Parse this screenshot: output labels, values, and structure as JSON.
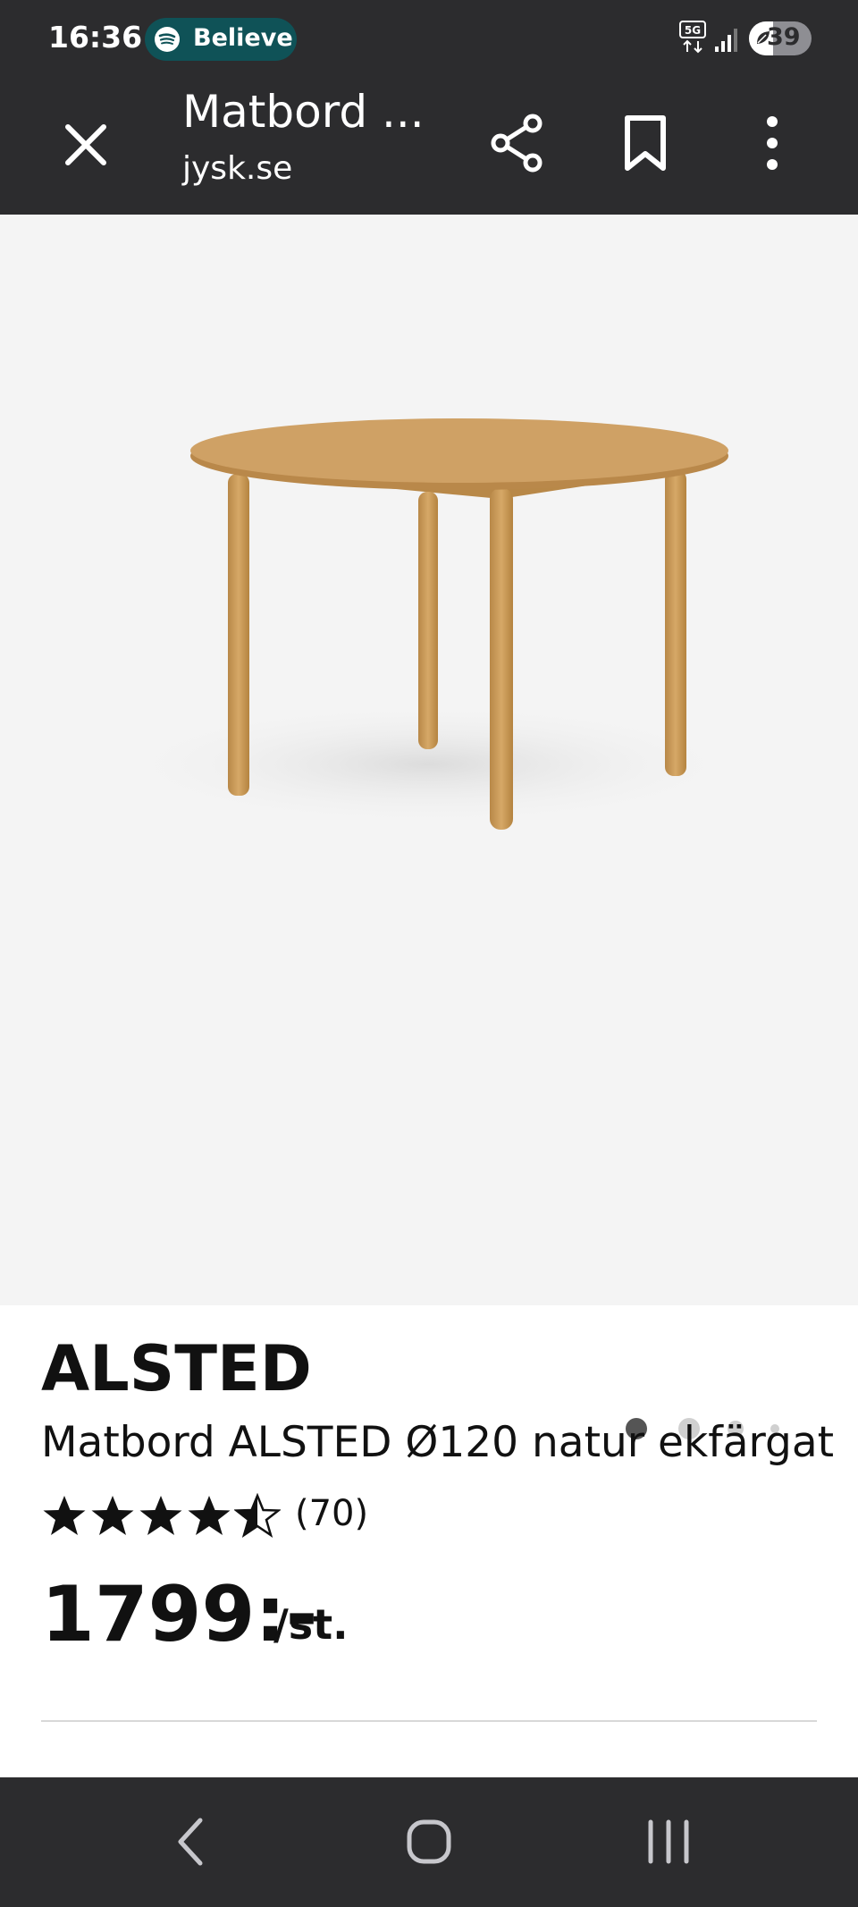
{
  "status_bar": {
    "time": "16:36",
    "spotify_label": "Believe",
    "network": "5G",
    "battery": "39",
    "battery_level": 0.39
  },
  "app_bar": {
    "title": "Matbord ...",
    "subtitle": "jysk.se"
  },
  "product": {
    "brand": "ALSTED",
    "name": "Matbord ALSTED Ø120 natur ekfärgat",
    "rating_value": 4.5,
    "rating_max": 5,
    "rating_count": "(70)",
    "price": "1799:-",
    "price_unit": "/st."
  },
  "carousel": {
    "total": 4,
    "active_index": 0
  },
  "colors": {
    "chrome": "#2c2c2e",
    "spotify_pill": "#0f5257",
    "image_bg": "#f4f4f4",
    "wood": "#c99a5b"
  }
}
